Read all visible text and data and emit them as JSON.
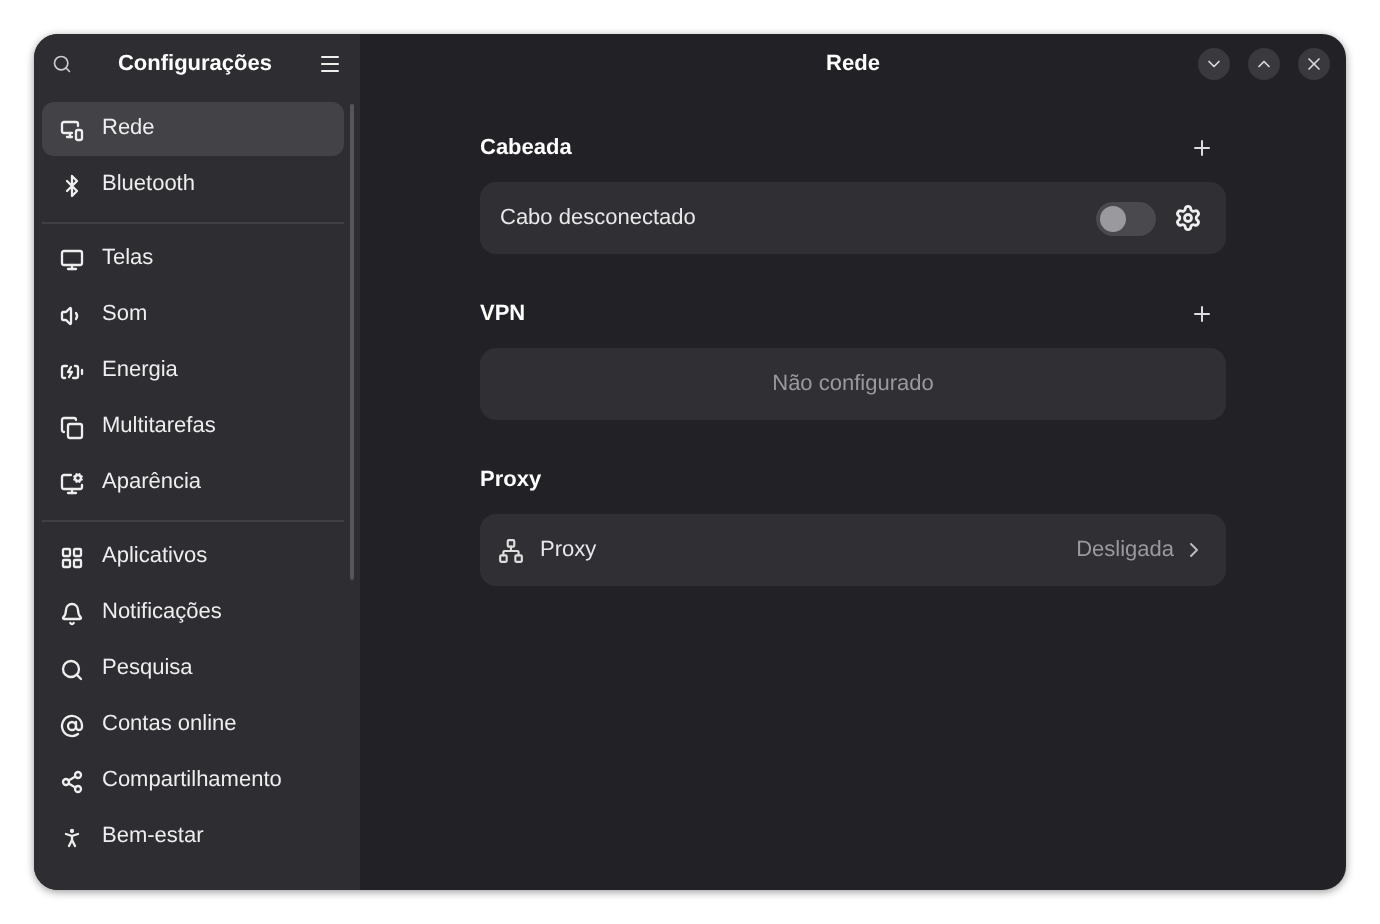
{
  "sidebar": {
    "title": "Configurações",
    "groups": [
      [
        {
          "label": "Rede",
          "selected": true
        },
        {
          "label": "Bluetooth",
          "selected": false
        }
      ],
      [
        {
          "label": "Telas",
          "selected": false
        },
        {
          "label": "Som",
          "selected": false
        },
        {
          "label": "Energia",
          "selected": false
        },
        {
          "label": "Multitarefas",
          "selected": false
        },
        {
          "label": "Aparência",
          "selected": false
        }
      ],
      [
        {
          "label": "Aplicativos",
          "selected": false
        },
        {
          "label": "Notificações",
          "selected": false
        },
        {
          "label": "Pesquisa",
          "selected": false
        },
        {
          "label": "Contas online",
          "selected": false
        },
        {
          "label": "Compartilhamento",
          "selected": false
        },
        {
          "label": "Bem-estar",
          "selected": false
        }
      ]
    ]
  },
  "window": {
    "title": "Rede"
  },
  "sections": [
    {
      "heading": "Cabeada",
      "addable": true,
      "row": {
        "kind": "toggle",
        "label": "Cabo desconectado",
        "on": false
      }
    },
    {
      "heading": "VPN",
      "addable": true,
      "row": {
        "kind": "empty",
        "label": "Não configurado"
      }
    },
    {
      "heading": "Proxy",
      "addable": false,
      "row": {
        "kind": "link",
        "label": "Proxy",
        "value": "Desligada"
      }
    }
  ]
}
